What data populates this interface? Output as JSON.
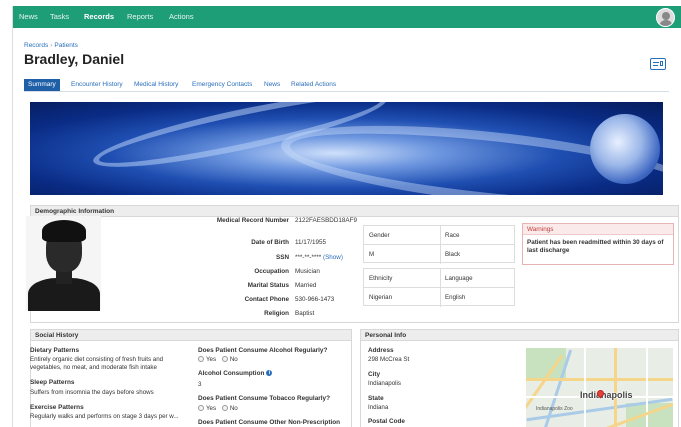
{
  "nav": {
    "items": [
      "News",
      "Tasks",
      "Records",
      "Reports",
      "Actions"
    ],
    "active": "Records"
  },
  "breadcrumb": [
    "Records",
    "Patients"
  ],
  "page_title": "Bradley, Daniel",
  "tabs": [
    "Summary",
    "Encounter History",
    "Medical History",
    "Emergency Contacts",
    "News",
    "Related Actions"
  ],
  "active_tab": "Summary",
  "demographics": {
    "header": "Demographic Information",
    "fields": [
      {
        "label": "Medical Record Number",
        "value": "2122FAESBDD18AF9"
      },
      {
        "label": "Date of Birth",
        "value": "11/17/1955"
      },
      {
        "label": "SSN",
        "value": "***-**-****",
        "link": "(Show)"
      },
      {
        "label": "Occupation",
        "value": "Musician"
      },
      {
        "label": "Marital Status",
        "value": "Married"
      },
      {
        "label": "Contact Phone",
        "value": "530-966-1473"
      },
      {
        "label": "Religion",
        "value": "Baptist"
      }
    ],
    "gender_race": {
      "h1": "Gender",
      "h2": "Race",
      "v1": "M",
      "v2": "Black"
    },
    "ethnicity_language": {
      "h1": "Ethnicity",
      "h2": "Language",
      "v1": "Nigerian",
      "v2": "English"
    },
    "warnings": {
      "title": "Warnings",
      "text": "Patient has been readmitted within 30 days of last discharge"
    }
  },
  "social": {
    "header": "Social History",
    "dietary_label": "Dietary Patterns",
    "dietary_text": "Entirely organic diet consisting of fresh fruits and vegetables, no meat, and moderate fish intake",
    "sleep_label": "Sleep Patterns",
    "sleep_text": "Suffers from insomnia the days before shows",
    "exercise_label": "Exercise Patterns",
    "exercise_text": "Regularly walks and performs on stage 3 days per w...",
    "alcohol_q": "Does Patient Consume Alcohol Regularly?",
    "yes": "Yes",
    "no": "No",
    "alcohol_consumption_label": "Alcohol Consumption",
    "alcohol_consumption_value": "3",
    "tobacco_q": "Does Patient Consume Tobacco Regularly?",
    "other_q": "Does Patient Consume Other Non-Prescription Drugs Regularly?"
  },
  "personal": {
    "header": "Personal Info",
    "address_label": "Address",
    "address_value": "298 McCrea St",
    "city_label": "City",
    "city_value": "Indianapolis",
    "state_label": "State",
    "state_value": "Indiana",
    "postal_label": "Postal Code",
    "map_city": "Indianapolis",
    "map_zoo": "Indianapolis Zoo"
  }
}
